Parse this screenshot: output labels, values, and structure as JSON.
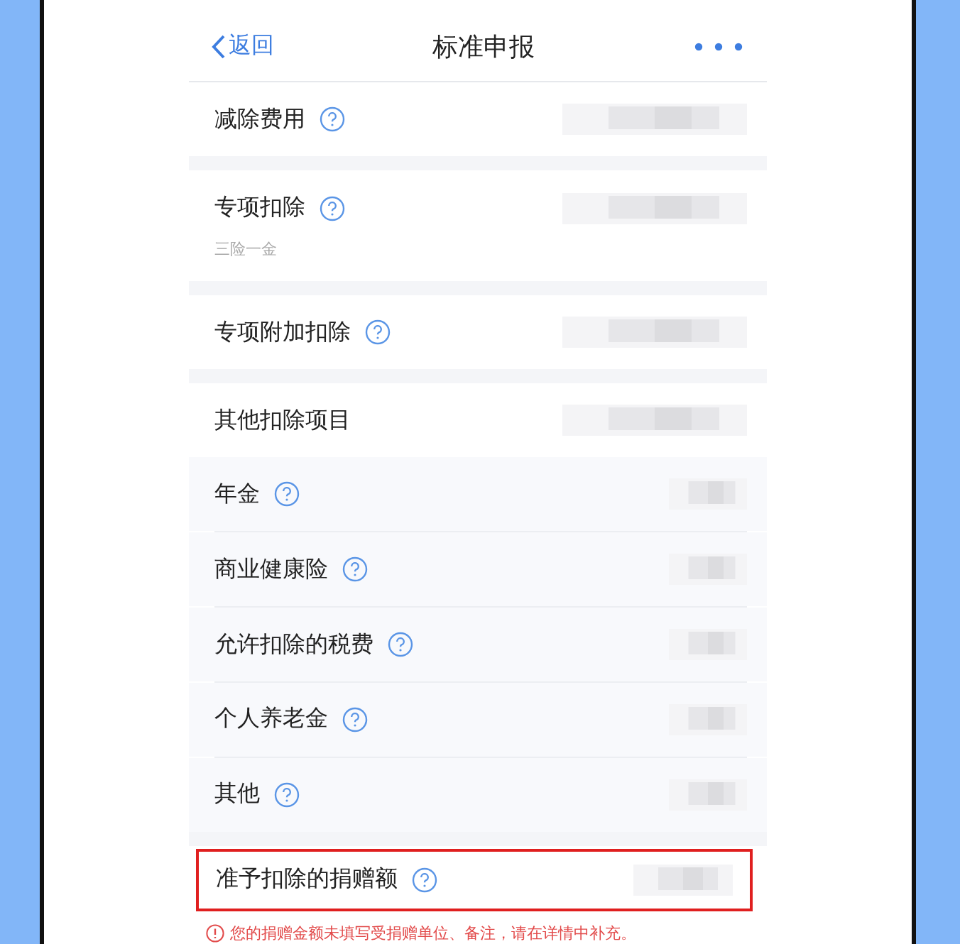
{
  "header": {
    "back_label": "返回",
    "title": "标准申报"
  },
  "sections": [
    {
      "rows": [
        {
          "kind": "main",
          "label": "减除费用",
          "help": true
        }
      ]
    },
    {
      "rows": [
        {
          "kind": "main",
          "label": "专项扣除",
          "help": true,
          "subtitle": "三险一金"
        }
      ]
    },
    {
      "rows": [
        {
          "kind": "main",
          "label": "专项附加扣除",
          "help": true
        }
      ]
    },
    {
      "rows": [
        {
          "kind": "main",
          "label": "其他扣除项目",
          "help": false
        },
        {
          "kind": "sub",
          "label": "年金",
          "help": true
        },
        {
          "kind": "sub",
          "label": "商业健康险",
          "help": true
        },
        {
          "kind": "sub",
          "label": "允许扣除的税费",
          "help": true
        },
        {
          "kind": "sub",
          "label": "个人养老金",
          "help": true
        },
        {
          "kind": "sub",
          "label": "其他",
          "help": true
        }
      ]
    },
    {
      "rows": [
        {
          "kind": "main",
          "label": "准予扣除的捐赠额",
          "help": true,
          "flagged": true,
          "error": "您的捐赠金额未填写受捐赠单位、备注，请在详情中补充。"
        }
      ]
    }
  ]
}
